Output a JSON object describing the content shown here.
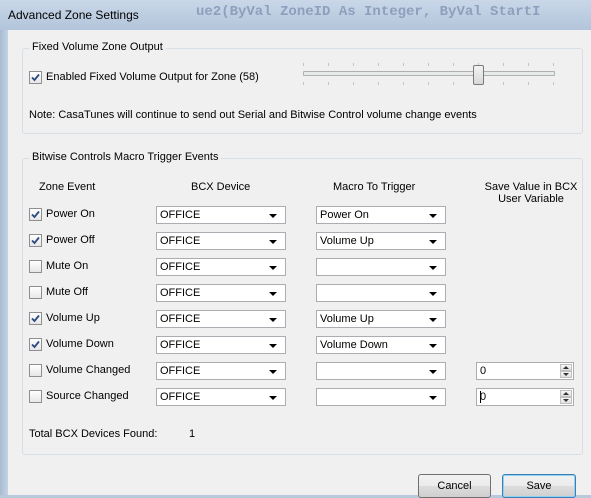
{
  "window": {
    "title": "Advanced Zone Settings",
    "background_code": "ue2(ByVal ZoneID As Integer, ByVal StartI"
  },
  "fixed_volume": {
    "group_label": "Fixed Volume Zone Output",
    "checkbox_label": "Enabled Fixed Volume Output for Zone  (58)",
    "checked": true,
    "slider_level_fraction": 0.7,
    "note": "Note: CasaTunes will continue to send out Serial and Bitwise Control volume change events"
  },
  "bitwise": {
    "group_label": "Bitwise Controls Macro Trigger Events",
    "headers": {
      "zone_event": "Zone Event",
      "bcx_device": "BCX Device",
      "macro": "Macro To Trigger",
      "save_value": "Save Value in BCX User Variable"
    },
    "rows": [
      {
        "event": "Power On",
        "checked": true,
        "device": "OFFICE",
        "macro": "Power On",
        "save_value": null
      },
      {
        "event": "Power Off",
        "checked": true,
        "device": "OFFICE",
        "macro": "Volume Up",
        "save_value": null
      },
      {
        "event": "Mute On",
        "checked": false,
        "device": "OFFICE",
        "macro": "",
        "save_value": null
      },
      {
        "event": "Mute Off",
        "checked": false,
        "device": "OFFICE",
        "macro": "",
        "save_value": null
      },
      {
        "event": "Volume Up",
        "checked": true,
        "device": "OFFICE",
        "macro": "Volume Up",
        "save_value": null
      },
      {
        "event": "Volume Down",
        "checked": true,
        "device": "OFFICE",
        "macro": "Volume Down",
        "save_value": null
      },
      {
        "event": "Volume Changed",
        "checked": false,
        "device": "OFFICE",
        "macro": "",
        "save_value": "0"
      },
      {
        "event": "Source Changed",
        "checked": false,
        "device": "OFFICE",
        "macro": "",
        "save_value": "0"
      }
    ],
    "total_label": "Total BCX Devices Found:",
    "total_value": "1"
  },
  "buttons": {
    "cancel": "Cancel",
    "save": "Save"
  },
  "colors": {
    "accent": "#3c7fb1",
    "check": "#2a4a7f"
  }
}
